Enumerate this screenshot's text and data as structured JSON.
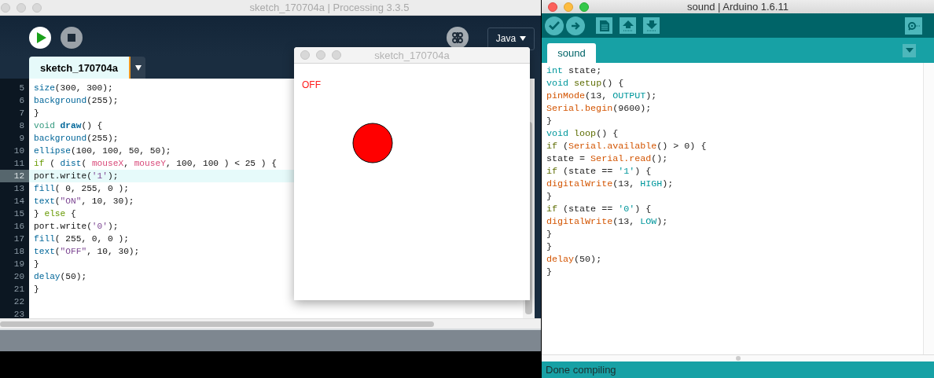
{
  "processing_window": {
    "title": "sketch_170704a | Processing 3.3.5",
    "mode": "Java",
    "tab": {
      "label": "sketch_170704a",
      "selected": true
    },
    "lines": [
      {
        "number": "5",
        "selected": false,
        "tokens": [
          {
            "kind": "func",
            "text": "size"
          },
          {
            "kind": "plain",
            "text": "(300, 300);"
          }
        ]
      },
      {
        "number": "6",
        "selected": false,
        "tokens": [
          {
            "kind": "func",
            "text": "background"
          },
          {
            "kind": "plain",
            "text": "(255);"
          }
        ]
      },
      {
        "number": "7",
        "selected": false,
        "tokens": [
          {
            "kind": "plain",
            "text": "}"
          }
        ]
      },
      {
        "number": "8",
        "selected": false,
        "tokens": [
          {
            "kind": "type",
            "text": "void "
          },
          {
            "kind": "bold",
            "text": "draw"
          },
          {
            "kind": "plain",
            "text": "() {"
          }
        ]
      },
      {
        "number": "9",
        "selected": false,
        "tokens": [
          {
            "kind": "func",
            "text": "background"
          },
          {
            "kind": "plain",
            "text": "(255);"
          }
        ]
      },
      {
        "number": "10",
        "selected": false,
        "tokens": [
          {
            "kind": "func",
            "text": "ellipse"
          },
          {
            "kind": "plain",
            "text": "(100, 100, 50, 50);"
          }
        ]
      },
      {
        "number": "11",
        "selected": false,
        "tokens": [
          {
            "kind": "keyword",
            "text": "if"
          },
          {
            "kind": "plain",
            "text": " ( "
          },
          {
            "kind": "func",
            "text": "dist"
          },
          {
            "kind": "plain",
            "text": "( "
          },
          {
            "kind": "var",
            "text": "mouseX"
          },
          {
            "kind": "plain",
            "text": ", "
          },
          {
            "kind": "var",
            "text": "mouseY"
          },
          {
            "kind": "plain",
            "text": ", 100, 100 ) < 25 ) {"
          }
        ]
      },
      {
        "number": "12",
        "selected": true,
        "tokens": [
          {
            "kind": "plain",
            "text": "port.write("
          },
          {
            "kind": "str",
            "text": "'1'"
          },
          {
            "kind": "plain",
            "text": ");"
          }
        ]
      },
      {
        "number": "13",
        "selected": false,
        "tokens": [
          {
            "kind": "func",
            "text": "fill"
          },
          {
            "kind": "plain",
            "text": "( 0, 255, 0 );"
          }
        ]
      },
      {
        "number": "14",
        "selected": false,
        "tokens": [
          {
            "kind": "func",
            "text": "text"
          },
          {
            "kind": "plain",
            "text": "("
          },
          {
            "kind": "str",
            "text": "\"ON\""
          },
          {
            "kind": "plain",
            "text": ", 10, 30);"
          }
        ]
      },
      {
        "number": "15",
        "selected": false,
        "tokens": [
          {
            "kind": "plain",
            "text": "} "
          },
          {
            "kind": "keyword",
            "text": "else"
          },
          {
            "kind": "plain",
            "text": " {"
          }
        ]
      },
      {
        "number": "16",
        "selected": false,
        "tokens": [
          {
            "kind": "plain",
            "text": "port.write("
          },
          {
            "kind": "str",
            "text": "'0'"
          },
          {
            "kind": "plain",
            "text": ");"
          }
        ]
      },
      {
        "number": "17",
        "selected": false,
        "tokens": [
          {
            "kind": "func",
            "text": "fill"
          },
          {
            "kind": "plain",
            "text": "( 255, 0, 0 );"
          }
        ]
      },
      {
        "number": "18",
        "selected": false,
        "tokens": [
          {
            "kind": "func",
            "text": "text"
          },
          {
            "kind": "plain",
            "text": "("
          },
          {
            "kind": "str",
            "text": "\"OFF\""
          },
          {
            "kind": "plain",
            "text": ", 10, 30);"
          }
        ]
      },
      {
        "number": "19",
        "selected": false,
        "tokens": [
          {
            "kind": "plain",
            "text": "}"
          }
        ]
      },
      {
        "number": "20",
        "selected": false,
        "tokens": [
          {
            "kind": "func",
            "text": "delay"
          },
          {
            "kind": "plain",
            "text": "(50);"
          }
        ]
      },
      {
        "number": "21",
        "selected": false,
        "tokens": [
          {
            "kind": "plain",
            "text": "}"
          }
        ]
      },
      {
        "number": "22",
        "selected": false
      },
      {
        "number": "23",
        "selected": false
      }
    ]
  },
  "sketch_window": {
    "title": "sketch_170704a",
    "label": "OFF"
  },
  "arduino_window": {
    "title": "sound | Arduino 1.6.11",
    "tab": {
      "label": "sound",
      "selected": true
    },
    "lines": [
      [
        {
          "kind": "type",
          "text": "int"
        },
        {
          "kind": "plain",
          "text": " state;"
        }
      ],
      [
        {
          "kind": "type",
          "text": "void "
        },
        {
          "kind": "olive",
          "text": "setup"
        },
        {
          "kind": "plain",
          "text": "() {"
        }
      ],
      [
        {
          "kind": "func",
          "text": "pinMode"
        },
        {
          "kind": "plain",
          "text": "(13, "
        },
        {
          "kind": "type",
          "text": "OUTPUT"
        },
        {
          "kind": "plain",
          "text": ");"
        }
      ],
      [
        {
          "kind": "func",
          "text": "Serial.begin"
        },
        {
          "kind": "plain",
          "text": "(9600);"
        }
      ],
      [
        {
          "kind": "plain",
          "text": "}"
        }
      ],
      [
        {
          "kind": "type",
          "text": "void "
        },
        {
          "kind": "olive",
          "text": "loop"
        },
        {
          "kind": "plain",
          "text": "() {"
        }
      ],
      [
        {
          "kind": "olive",
          "text": "if"
        },
        {
          "kind": "plain",
          "text": " ("
        },
        {
          "kind": "func",
          "text": "Serial.available"
        },
        {
          "kind": "plain",
          "text": "() > 0) {"
        }
      ],
      [
        {
          "kind": "plain",
          "text": "state = "
        },
        {
          "kind": "func",
          "text": "Serial.read"
        },
        {
          "kind": "plain",
          "text": "();"
        }
      ],
      [
        {
          "kind": "olive",
          "text": "if"
        },
        {
          "kind": "plain",
          "text": " (state == "
        },
        {
          "kind": "type",
          "text": "'1'"
        },
        {
          "kind": "plain",
          "text": ") {"
        }
      ],
      [
        {
          "kind": "func",
          "text": "digitalWrite"
        },
        {
          "kind": "plain",
          "text": "(13, "
        },
        {
          "kind": "type",
          "text": "HIGH"
        },
        {
          "kind": "plain",
          "text": ");"
        }
      ],
      [
        {
          "kind": "plain",
          "text": "}"
        }
      ],
      [
        {
          "kind": "olive",
          "text": "if"
        },
        {
          "kind": "plain",
          "text": " (state == "
        },
        {
          "kind": "type",
          "text": "'0'"
        },
        {
          "kind": "plain",
          "text": ") {"
        }
      ],
      [
        {
          "kind": "func",
          "text": "digitalWrite"
        },
        {
          "kind": "plain",
          "text": "(13, "
        },
        {
          "kind": "type",
          "text": "LOW"
        },
        {
          "kind": "plain",
          "text": ");"
        }
      ],
      [
        {
          "kind": "plain",
          "text": "}"
        }
      ],
      [
        {
          "kind": "plain",
          "text": "}"
        }
      ],
      [
        {
          "kind": "func",
          "text": "delay"
        },
        {
          "kind": "plain",
          "text": "(50);"
        }
      ],
      [
        {
          "kind": "plain",
          "text": "}"
        }
      ]
    ],
    "status": "Done compiling"
  }
}
